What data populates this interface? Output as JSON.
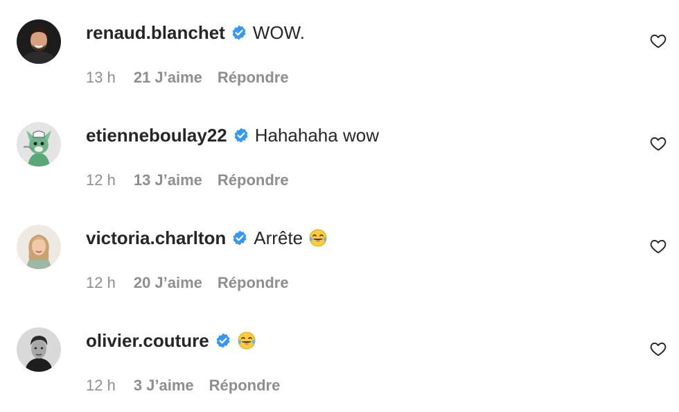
{
  "comments": [
    {
      "username": "renaud.blanchet",
      "text": "WOW.",
      "emoji": "",
      "time": "13 h",
      "likes": "21 J’aime",
      "reply_label": "Répondre",
      "avatar_icon": "man-portrait-avatar"
    },
    {
      "username": "etienneboulay22",
      "text": "Hahahaha wow",
      "emoji": "",
      "time": "12 h",
      "likes": "13 J’aime",
      "reply_label": "Répondre",
      "avatar_icon": "cartoon-wolf-avatar"
    },
    {
      "username": "victoria.charlton",
      "text": "Arrête",
      "emoji": "😂",
      "time": "12 h",
      "likes": "20 J’aime",
      "reply_label": "Répondre",
      "avatar_icon": "woman-portrait-avatar"
    },
    {
      "username": "olivier.couture",
      "text": "",
      "emoji": "😂",
      "time": "12 h",
      "likes": "3 J’aime",
      "reply_label": "Répondre",
      "avatar_icon": "man-bw-portrait-avatar"
    }
  ],
  "colors": {
    "verified_badge": "#3897f0",
    "username": "#262626",
    "meta": "#8e8e8e",
    "background": "#ffffff"
  }
}
